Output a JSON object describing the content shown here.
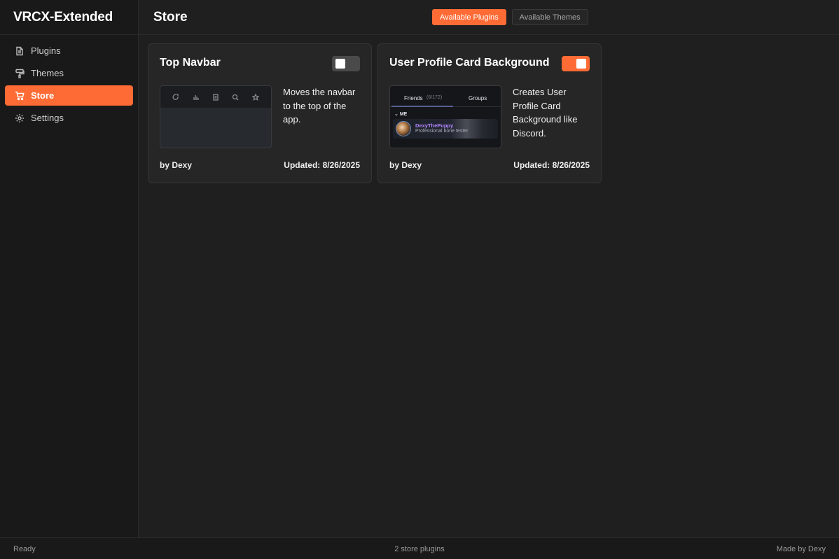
{
  "app": {
    "title": "VRCX-Extended"
  },
  "sidebar": {
    "items": [
      {
        "label": "Plugins",
        "icon": "document-icon"
      },
      {
        "label": "Themes",
        "icon": "paint-roller-icon"
      },
      {
        "label": "Store",
        "icon": "cart-icon",
        "active": true
      },
      {
        "label": "Settings",
        "icon": "gear-icon"
      }
    ]
  },
  "header": {
    "title": "Store",
    "tabs": [
      {
        "label": "Available Plugins",
        "active": true
      },
      {
        "label": "Available Themes",
        "active": false
      }
    ]
  },
  "cards": [
    {
      "title": "Top Navbar",
      "enabled": false,
      "description": "Moves the navbar to the top of the app.",
      "author": "by Dexy",
      "updated": "Updated: 8/26/2025"
    },
    {
      "title": "User Profile Card Background",
      "enabled": true,
      "description": "Creates User Profile Card Background like Discord.",
      "author": "by Dexy",
      "updated": "Updated: 8/26/2025",
      "preview": {
        "tab_friends": "Friends",
        "tab_friends_count": "(6/172)",
        "tab_groups": "Groups",
        "section": "ME",
        "name": "DexyThePuppy",
        "status": "Professional bone tester"
      }
    }
  ],
  "footer": {
    "left": "Ready",
    "center": "2 store plugins",
    "right": "Made by Dexy"
  },
  "colors": {
    "accent": "#ff6b35",
    "background": "#1f1f1f",
    "sidebar": "#191919",
    "card": "#262626"
  }
}
